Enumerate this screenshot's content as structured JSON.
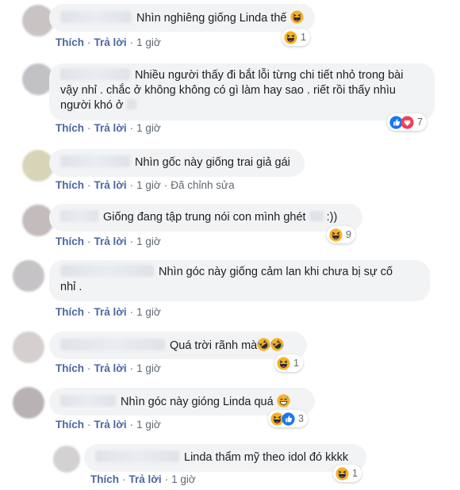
{
  "comments": [
    {
      "text": "Nhìn nghiêng giống Linda thế",
      "actions": {
        "like": "Thích",
        "reply": "Trả lời",
        "time": "1 giờ",
        "edited": ""
      },
      "reaction_count": "1",
      "reaction_icons": [
        "haha-icon"
      ],
      "avatar_color": "#c9c4c4"
    },
    {
      "line1": "Nhiều người thấy đi bắt lỗi từng chi tiết nhỏ trong bài",
      "line2": "vậy nhỉ . chắc ở không không có gì làm hay sao . riết rồi thấy nhìu",
      "line3": "người khó ở",
      "actions": {
        "like": "Thích",
        "reply": "Trả lời",
        "time": "1 giờ",
        "edited": ""
      },
      "reaction_count": "7",
      "reaction_icons": [
        "like-icon",
        "love-icon"
      ],
      "avatar_color": "#c2c2c6"
    },
    {
      "text": "Nhìn gốc này giống trai giả gái",
      "actions": {
        "like": "Thích",
        "reply": "Trả lời",
        "time": "1 giờ",
        "edited": "Đã chỉnh sửa"
      },
      "reaction_count": "",
      "reaction_icons": [],
      "avatar_color": "#d8d4b8"
    },
    {
      "text": "Giống đang tập trung nói con mình ghét",
      "text_tail": ":))",
      "actions": {
        "like": "Thích",
        "reply": "Trả lời",
        "time": "1 giờ",
        "edited": ""
      },
      "reaction_count": "9",
      "reaction_icons": [
        "haha-icon"
      ],
      "avatar_color": "#c4bcbc"
    },
    {
      "line1": "Nhìn góc này giống cảm lan khi chưa bị sự cố",
      "line2": "nhỉ .",
      "actions": {
        "like": "Thích",
        "reply": "Trả lời",
        "time": "1 giờ",
        "edited": ""
      },
      "reaction_count": "",
      "reaction_icons": [],
      "avatar_color": "#c6c3c6"
    },
    {
      "text": "Quá trời rãnh mà",
      "actions": {
        "like": "Thích",
        "reply": "Trả lời",
        "time": "1 giờ",
        "edited": ""
      },
      "reaction_count": "1",
      "reaction_icons": [
        "haha-icon"
      ],
      "avatar_color": "#d6cfd0"
    },
    {
      "text": "Nhìn góc này gióng Linda quá",
      "actions": {
        "like": "Thích",
        "reply": "Trả lời",
        "time": "1 giờ",
        "edited": ""
      },
      "reaction_count": "3",
      "reaction_icons": [
        "haha-icon",
        "like-icon"
      ],
      "avatar_color": "#b9b2b4"
    },
    {
      "text": "Linda thẩm mỹ theo idol đó kkkk",
      "actions": {
        "like": "Thích",
        "reply": "Trả lời",
        "time": "1 giờ",
        "edited": ""
      },
      "reaction_count": "1",
      "reaction_icons": [
        "haha-icon"
      ],
      "avatar_color": "#d3d1d2"
    }
  ],
  "colors": {
    "bubble": "#f2f3f5",
    "action_link": "#4b67a1",
    "meta_text": "#606770",
    "like_blue": "#1877f2",
    "love_red": "#f33e58",
    "haha_yellow": "#f7b125"
  }
}
